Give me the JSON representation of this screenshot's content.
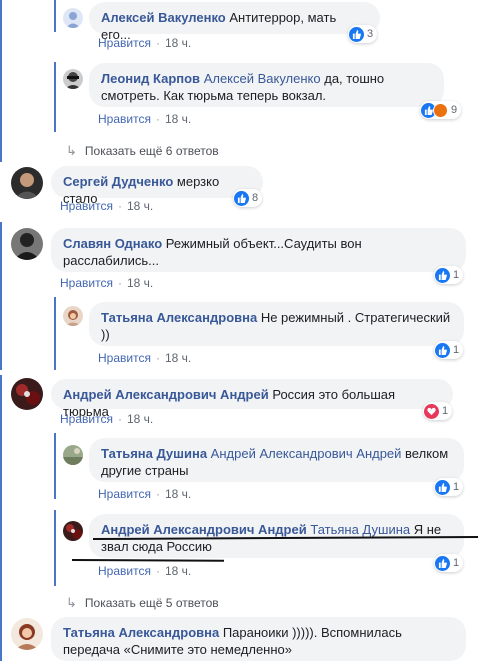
{
  "more_replies_1": "Показать ещё 6 ответов",
  "more_replies_2": "Показать ещё 5 ответов",
  "like_label": "Нравится",
  "comments": [
    {
      "author": "Алексей Вакуленко",
      "mention": "",
      "text": "Антитеррор, мать его...",
      "time": "18 ч.",
      "reactions": "3"
    },
    {
      "author": "Леонид Карпов",
      "mention": "Алексей Вакуленко",
      "text": " да, тошно смотреть. Как тюрьма теперь вокзал.",
      "time": "18 ч.",
      "reactions": "9"
    },
    {
      "author": "Сергей Дудченко",
      "mention": "",
      "text": "мерзко стало",
      "time": "18 ч.",
      "reactions": "8"
    },
    {
      "author": "Славян Однако",
      "mention": "",
      "text": "Режимный объект...Саудиты вон расслабились...",
      "time": "18 ч.",
      "reactions": "1"
    },
    {
      "author": "Татьяна Александровна",
      "mention": "",
      "text": "Не режимный . Стратегический ))",
      "time": "18 ч.",
      "reactions": "1"
    },
    {
      "author": "Андрей Александрович Андрей",
      "mention": "",
      "text": "Россия это большая тюрьма",
      "time": "18 ч.",
      "reactions": "1"
    },
    {
      "author": "Татьяна Душина",
      "mention": "Андрей Александрович Андрей",
      "text": " велком другие страны",
      "time": "18 ч.",
      "reactions": "1"
    },
    {
      "author": "Андрей Александрович Андрей",
      "mention": "Татьяна Душина",
      "text": " Я не звал сюда Россию",
      "time": "18 ч.",
      "reactions": "1"
    },
    {
      "author": "Татьяна Александровна",
      "mention": "",
      "text": "Параноики ))))). Вспомнилась передача «Снимите это немедленно»",
      "time": "",
      "reactions": ""
    }
  ],
  "colors": {
    "link": "#385898",
    "like": "#1877f2",
    "love": "#e8385a",
    "thread_line": "#4a76c7"
  }
}
